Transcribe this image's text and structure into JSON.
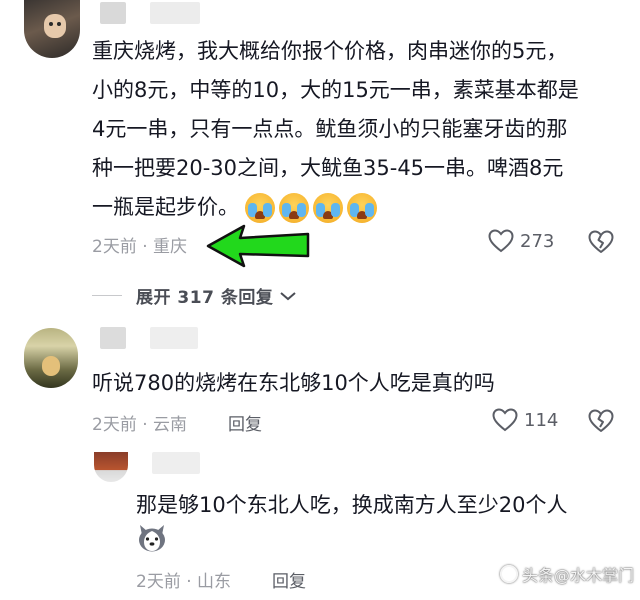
{
  "comment1": {
    "lines": [
      "重庆烧烤，我大概给你报个价格，肉串迷你的5元，",
      "小的8元，中等的10，大的15元一串，素菜基本都是",
      "4元一串，只有一点点。鱿鱼须小的只能塞牙齿的那",
      "种一把要20-30之间，大鱿鱼35-45一串。啤酒8元",
      "一瓶是起步价。"
    ],
    "emoji": "loudly-crying-face",
    "emoji_count": 4,
    "time_location": "2天前 · 重庆",
    "like_count": "273",
    "expand_label": "展开 317 条回复"
  },
  "comment2": {
    "text": "听说780的烧烤在东北够10个人吃是真的吗",
    "time_location": "2天前 · 云南",
    "reply_label": "回复",
    "like_count": "114"
  },
  "comment3": {
    "text": "那是够10个东北人吃，换成南方人至少20个人",
    "emoji": "husky-dog",
    "time_location": "2天前 · 山东",
    "reply_label": "回复"
  },
  "annotation": {
    "color": "#22d81c",
    "direction": "left"
  },
  "watermark": {
    "text": "头条@水木掌门"
  }
}
